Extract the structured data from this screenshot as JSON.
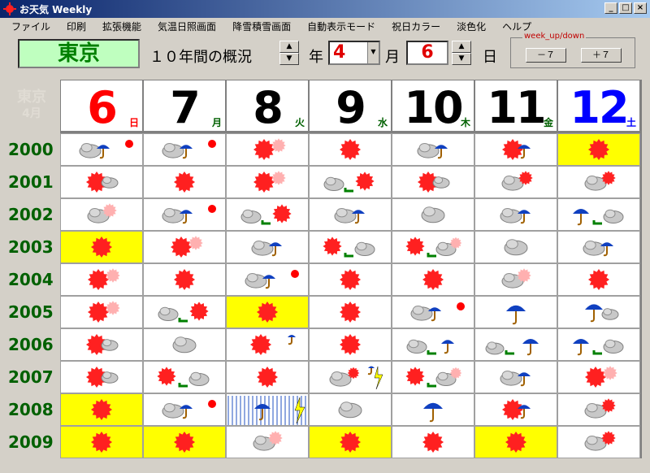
{
  "window": {
    "title": "お天気 Weekly",
    "min": "_",
    "max": "□",
    "close": "×"
  },
  "menu": [
    "ファイル",
    "印刷",
    "拡張機能",
    "気温日照画面",
    "降雪積雪画面",
    "自動表示モード",
    "祝日カラー",
    "淡色化",
    "ヘルプ"
  ],
  "toolbar": {
    "city": "東京",
    "overview": "１０年間の概況",
    "year_value": "4",
    "year_label": "年",
    "month_label": "月",
    "month_value": "6",
    "day_label": "日",
    "week_caption": "week_up/down",
    "week_minus": "－７",
    "week_plus": "＋７"
  },
  "corner": {
    "city": "東京",
    "month": "4月"
  },
  "days": [
    {
      "num": "6",
      "wd": "日",
      "color": "#ff0000",
      "wdcolor": "#ff0000"
    },
    {
      "num": "7",
      "wd": "月",
      "color": "#000000",
      "wdcolor": "#006000"
    },
    {
      "num": "8",
      "wd": "火",
      "color": "#000000",
      "wdcolor": "#006000"
    },
    {
      "num": "9",
      "wd": "水",
      "color": "#000000",
      "wdcolor": "#006000"
    },
    {
      "num": "10",
      "wd": "木",
      "color": "#000000",
      "wdcolor": "#006000"
    },
    {
      "num": "11",
      "wd": "金",
      "color": "#000000",
      "wdcolor": "#006000"
    },
    {
      "num": "12",
      "wd": "土",
      "color": "#0000ff",
      "wdcolor": "#0000ff"
    }
  ],
  "years": [
    "2000",
    "2001",
    "2002",
    "2003",
    "2004",
    "2005",
    "2006",
    "2007",
    "2008",
    "2009"
  ],
  "weather": [
    [
      "cloud-umbrella-sun",
      "cloud-umbrella-sun",
      "sun-cloudsun",
      "sun",
      "cloud-umbrella",
      "sun-umbrella",
      "sun-bg"
    ],
    [
      "sun-cloud",
      "sun",
      "sun-cloudsun",
      "cloud-then-sun",
      "sun-cloud",
      "cloud-sun",
      "cloud-sun"
    ],
    [
      "cloud-sun-faded",
      "cloud-umbrella-sun",
      "cloud-then-sun",
      "cloud-umbrella",
      "cloud",
      "cloud-umbrella",
      "umbrella-then-cloud"
    ],
    [
      "sun-bg",
      "sun-cloudsun",
      "cloud-umbrella",
      "sun-then-cloud",
      "sun-then-cloudsun",
      "cloud",
      "cloud-umbrella"
    ],
    [
      "sun-cloudsun",
      "sun",
      "cloud-umbrella-sun",
      "sun",
      "sun",
      "cloud-sun-faded",
      "sun"
    ],
    [
      "sun-cloudsun",
      "cloud-then-sun",
      "sun-bg",
      "sun",
      "cloud-umbrella-sun",
      "umbrella",
      "umbrella-cloud"
    ],
    [
      "sun-cloud",
      "cloud",
      "sun-smallumbrella",
      "sun",
      "cloud-then-umbrella",
      "cloud-then-umbrella-snow",
      "umbrella-then-cloud"
    ],
    [
      "sun-cloud",
      "sun-then-cloud",
      "sun",
      "cloud-sun-thunder",
      "sun-then-cloudsun",
      "cloud-umbrella",
      "sun-cloudsun"
    ],
    [
      "sun-bg",
      "cloud-umbrella-sun",
      "rain-umbrella-thunder",
      "cloud",
      "umbrella",
      "sun-umbrella",
      "cloud-sun"
    ],
    [
      "sun-bg",
      "sun-bg",
      "cloud-sun-faded",
      "sun-bg",
      "sun",
      "sun-bg",
      "cloud-sun"
    ]
  ]
}
